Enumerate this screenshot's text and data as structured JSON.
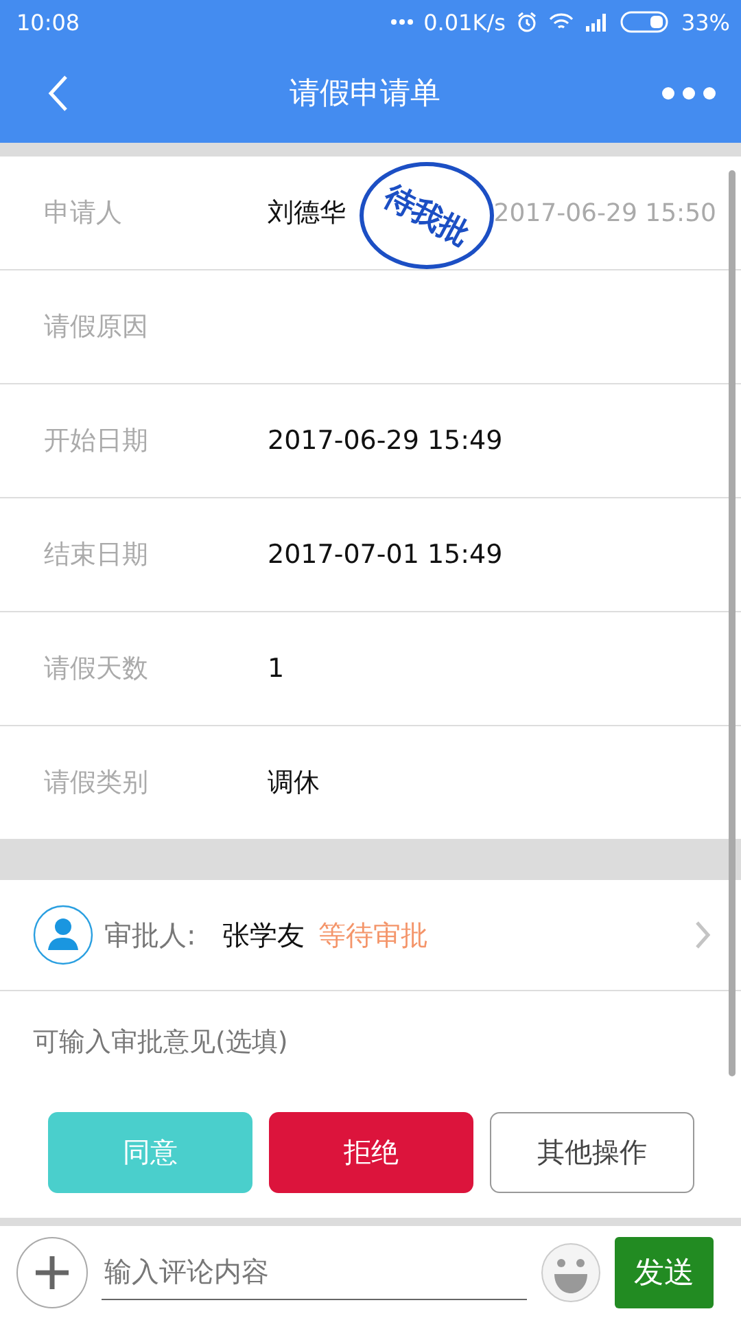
{
  "status_bar": {
    "time": "10:08",
    "network_speed": "0.01K/s",
    "battery": "33%"
  },
  "header": {
    "title": "请假申请单"
  },
  "stamp": {
    "text": "待我批"
  },
  "fields": [
    {
      "label": "申请人",
      "value": "刘德华",
      "timestamp": "2017-06-29 15:50"
    },
    {
      "label": "请假原因"
    },
    {
      "label": "开始日期",
      "value": "2017-06-29 15:49"
    },
    {
      "label": "结束日期",
      "value": "2017-07-01 15:49"
    },
    {
      "label": "请假天数",
      "value": "1"
    },
    {
      "label": "请假类别",
      "value": "调休"
    }
  ],
  "approver": {
    "label": "审批人:",
    "name": "张学友",
    "status": "等待审批"
  },
  "opinion": {
    "placeholder": "可输入审批意见(选填)"
  },
  "actions": [
    {
      "label": "同意",
      "kind": "approve"
    },
    {
      "label": "拒绝",
      "kind": "reject"
    },
    {
      "label": "其他操作",
      "kind": "other"
    }
  ],
  "comment_bar": {
    "placeholder": "输入评论内容",
    "send": "发送"
  }
}
